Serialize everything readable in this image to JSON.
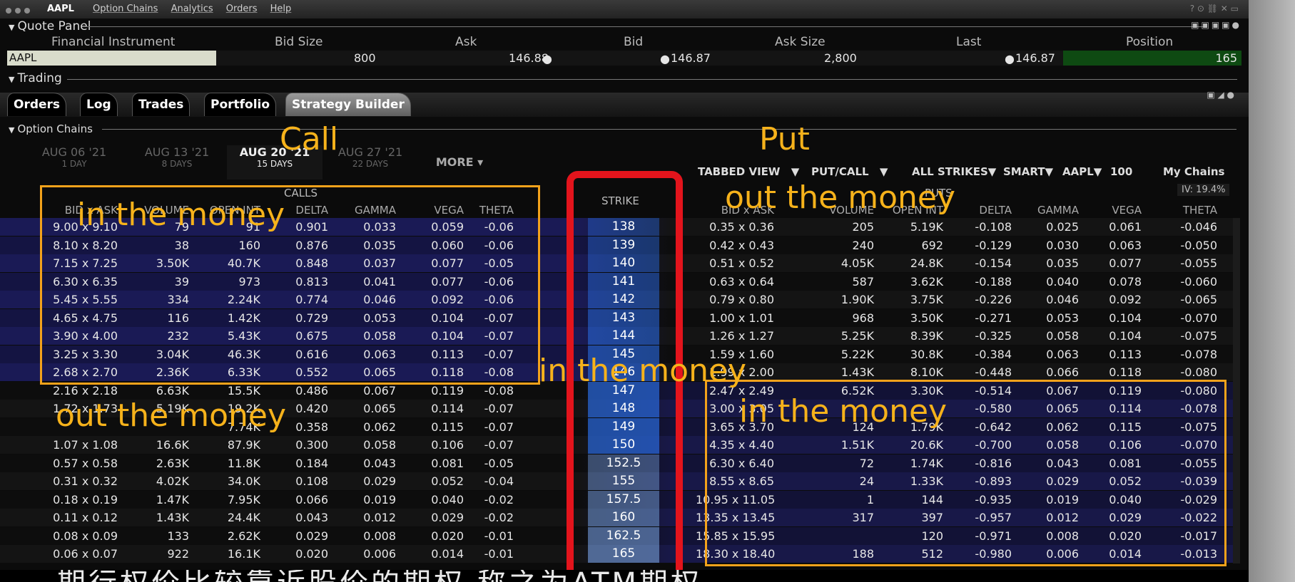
{
  "menubar": {
    "symbol": "AAPL",
    "menus": [
      "Option Chains",
      "Analytics",
      "Orders",
      "Help"
    ]
  },
  "quote_panel": {
    "title": "Quote Panel",
    "headers": [
      "Financial Instrument",
      "Bid Size",
      "Ask",
      "Bid",
      "Ask Size",
      "Last",
      "Position"
    ],
    "row": {
      "instrument": "AAPL",
      "bid_size": "800",
      "ask": "146.88",
      "bid": "146.87",
      "ask_size": "2,800",
      "last": "146.87",
      "position": "165"
    }
  },
  "trading": {
    "title": "Trading",
    "tabs": [
      "Orders",
      "Log",
      "Trades",
      "Portfolio",
      "Strategy Builder"
    ],
    "active_tab": "Strategy Builder"
  },
  "option_chains": {
    "title": "Option Chains",
    "expirations": [
      {
        "date": "AUG 06 '21",
        "days": "1 DAY"
      },
      {
        "date": "AUG 13 '21",
        "days": "8 DAYS"
      },
      {
        "date": "AUG 20 '21",
        "days": "15 DAYS"
      },
      {
        "date": "AUG 27 '21",
        "days": "22 DAYS"
      },
      {
        "date": "MORE ▾",
        "days": ""
      }
    ],
    "active_expiration": "AUG 20 '21",
    "toolbar": [
      "TABBED VIEW",
      "PUT/CALL",
      "ALL STRIKES",
      "SMART",
      "AAPL",
      "100",
      "My Chains"
    ],
    "iv": "IV: 19.4%",
    "calls_label": "CALLS",
    "puts_label": "PUTS",
    "strike_label": "STRIKE",
    "call_headers": [
      "BID x ASK",
      "VOLUME",
      "OPEN INT",
      "DELTA",
      "GAMMA",
      "VEGA",
      "THETA"
    ],
    "put_headers": [
      "BID x ASK",
      "VOLUME",
      "OPEN INT",
      "DELTA",
      "GAMMA",
      "VEGA",
      "THETA"
    ],
    "rows": [
      {
        "strike": "138",
        "c": [
          "9.00 x 9.10",
          "79",
          "91",
          "0.901",
          "0.033",
          "0.059",
          "-0.06"
        ],
        "p": [
          "0.35 x 0.36",
          "205",
          "5.19K",
          "-0.108",
          "0.025",
          "0.061",
          "-0.046"
        ]
      },
      {
        "strike": "139",
        "c": [
          "8.10 x 8.20",
          "38",
          "160",
          "0.876",
          "0.035",
          "0.060",
          "-0.06"
        ],
        "p": [
          "0.42 x 0.43",
          "240",
          "692",
          "-0.129",
          "0.030",
          "0.063",
          "-0.050"
        ]
      },
      {
        "strike": "140",
        "c": [
          "7.15 x 7.25",
          "3.50K",
          "40.7K",
          "0.848",
          "0.037",
          "0.077",
          "-0.05"
        ],
        "p": [
          "0.51 x 0.52",
          "4.05K",
          "24.8K",
          "-0.154",
          "0.035",
          "0.077",
          "-0.055"
        ]
      },
      {
        "strike": "141",
        "c": [
          "6.30 x 6.35",
          "39",
          "973",
          "0.813",
          "0.041",
          "0.077",
          "-0.06"
        ],
        "p": [
          "0.63 x 0.64",
          "587",
          "3.62K",
          "-0.188",
          "0.040",
          "0.078",
          "-0.060"
        ]
      },
      {
        "strike": "142",
        "c": [
          "5.45 x 5.55",
          "334",
          "2.24K",
          "0.774",
          "0.046",
          "0.092",
          "-0.06"
        ],
        "p": [
          "0.79 x 0.80",
          "1.90K",
          "3.75K",
          "-0.226",
          "0.046",
          "0.092",
          "-0.065"
        ]
      },
      {
        "strike": "143",
        "c": [
          "4.65 x 4.75",
          "116",
          "1.42K",
          "0.729",
          "0.053",
          "0.104",
          "-0.07"
        ],
        "p": [
          "1.00 x 1.01",
          "968",
          "3.50K",
          "-0.271",
          "0.053",
          "0.104",
          "-0.070"
        ]
      },
      {
        "strike": "144",
        "c": [
          "3.90 x 4.00",
          "232",
          "5.43K",
          "0.675",
          "0.058",
          "0.104",
          "-0.07"
        ],
        "p": [
          "1.26 x 1.27",
          "5.25K",
          "8.39K",
          "-0.325",
          "0.058",
          "0.104",
          "-0.075"
        ]
      },
      {
        "strike": "145",
        "c": [
          "3.25 x 3.30",
          "3.04K",
          "46.3K",
          "0.616",
          "0.063",
          "0.113",
          "-0.07"
        ],
        "p": [
          "1.59 x 1.60",
          "5.22K",
          "30.8K",
          "-0.384",
          "0.063",
          "0.113",
          "-0.078"
        ]
      },
      {
        "strike": "146",
        "c": [
          "2.68 x 2.70",
          "2.36K",
          "6.33K",
          "0.552",
          "0.065",
          "0.118",
          "-0.08"
        ],
        "p": [
          "1.99 x 2.00",
          "1.43K",
          "8.10K",
          "-0.448",
          "0.066",
          "0.118",
          "-0.080"
        ]
      },
      {
        "strike": "147",
        "c": [
          "2.16 x 2.18",
          "6.63K",
          "15.5K",
          "0.486",
          "0.067",
          "0.119",
          "-0.08"
        ],
        "p": [
          "2.47 x 2.49",
          "6.52K",
          "3.30K",
          "-0.514",
          "0.067",
          "0.119",
          "-0.080"
        ]
      },
      {
        "strike": "148",
        "c": [
          "1.72 x 1.73",
          "5.19K",
          "19.2K",
          "0.420",
          "0.065",
          "0.114",
          "-0.07"
        ],
        "p": [
          "3.00 x 3.05",
          "",
          "",
          "-0.580",
          "0.065",
          "0.114",
          "-0.078"
        ]
      },
      {
        "strike": "149",
        "c": [
          "",
          "",
          "7.74K",
          "0.358",
          "0.062",
          "0.115",
          "-0.07"
        ],
        "p": [
          "3.65 x 3.70",
          "124",
          "1.79K",
          "-0.642",
          "0.062",
          "0.115",
          "-0.075"
        ]
      },
      {
        "strike": "150",
        "c": [
          "1.07 x 1.08",
          "16.6K",
          "87.9K",
          "0.300",
          "0.058",
          "0.106",
          "-0.07"
        ],
        "p": [
          "4.35 x 4.40",
          "1.51K",
          "20.6K",
          "-0.700",
          "0.058",
          "0.106",
          "-0.070"
        ]
      },
      {
        "strike": "152.5",
        "c": [
          "0.57 x 0.58",
          "2.63K",
          "11.8K",
          "0.184",
          "0.043",
          "0.081",
          "-0.05"
        ],
        "p": [
          "6.30 x 6.40",
          "72",
          "1.74K",
          "-0.816",
          "0.043",
          "0.081",
          "-0.055"
        ]
      },
      {
        "strike": "155",
        "c": [
          "0.31 x 0.32",
          "4.02K",
          "34.0K",
          "0.108",
          "0.029",
          "0.052",
          "-0.04"
        ],
        "p": [
          "8.55 x 8.65",
          "24",
          "1.33K",
          "-0.893",
          "0.029",
          "0.052",
          "-0.039"
        ]
      },
      {
        "strike": "157.5",
        "c": [
          "0.18 x 0.19",
          "1.47K",
          "7.95K",
          "0.066",
          "0.019",
          "0.040",
          "-0.02"
        ],
        "p": [
          "10.95 x 11.05",
          "1",
          "144",
          "-0.935",
          "0.019",
          "0.040",
          "-0.029"
        ]
      },
      {
        "strike": "160",
        "c": [
          "0.11 x 0.12",
          "1.43K",
          "24.4K",
          "0.043",
          "0.012",
          "0.029",
          "-0.02"
        ],
        "p": [
          "13.35 x 13.45",
          "317",
          "397",
          "-0.957",
          "0.012",
          "0.029",
          "-0.022"
        ]
      },
      {
        "strike": "162.5",
        "c": [
          "0.08 x 0.09",
          "133",
          "2.62K",
          "0.029",
          "0.008",
          "0.020",
          "-0.01"
        ],
        "p": [
          "15.85 x 15.95",
          "",
          "120",
          "-0.971",
          "0.008",
          "0.020",
          "-0.017"
        ]
      },
      {
        "strike": "165",
        "c": [
          "0.06 x 0.07",
          "922",
          "16.1K",
          "0.020",
          "0.006",
          "0.014",
          "-0.01"
        ],
        "p": [
          "18.30 x 18.40",
          "188",
          "512",
          "-0.980",
          "0.006",
          "0.014",
          "-0.013"
        ]
      }
    ]
  },
  "annotations": {
    "call": "Call",
    "put": "Put",
    "calls_itm": "in the money",
    "calls_otm": "out the money",
    "puts_otm": "out the money",
    "puts_itm": "in the money",
    "strike_itm": "in the money"
  },
  "caption": "期行权价比较靠近股价的期权 称之为ATM期权",
  "colors": {
    "annotation": "#f6b21b",
    "red_highlight": "#e3141c",
    "call_itm_row": "#17174a",
    "put_itm_row": "#14143c",
    "strike_blue": "#1c4f9a"
  }
}
